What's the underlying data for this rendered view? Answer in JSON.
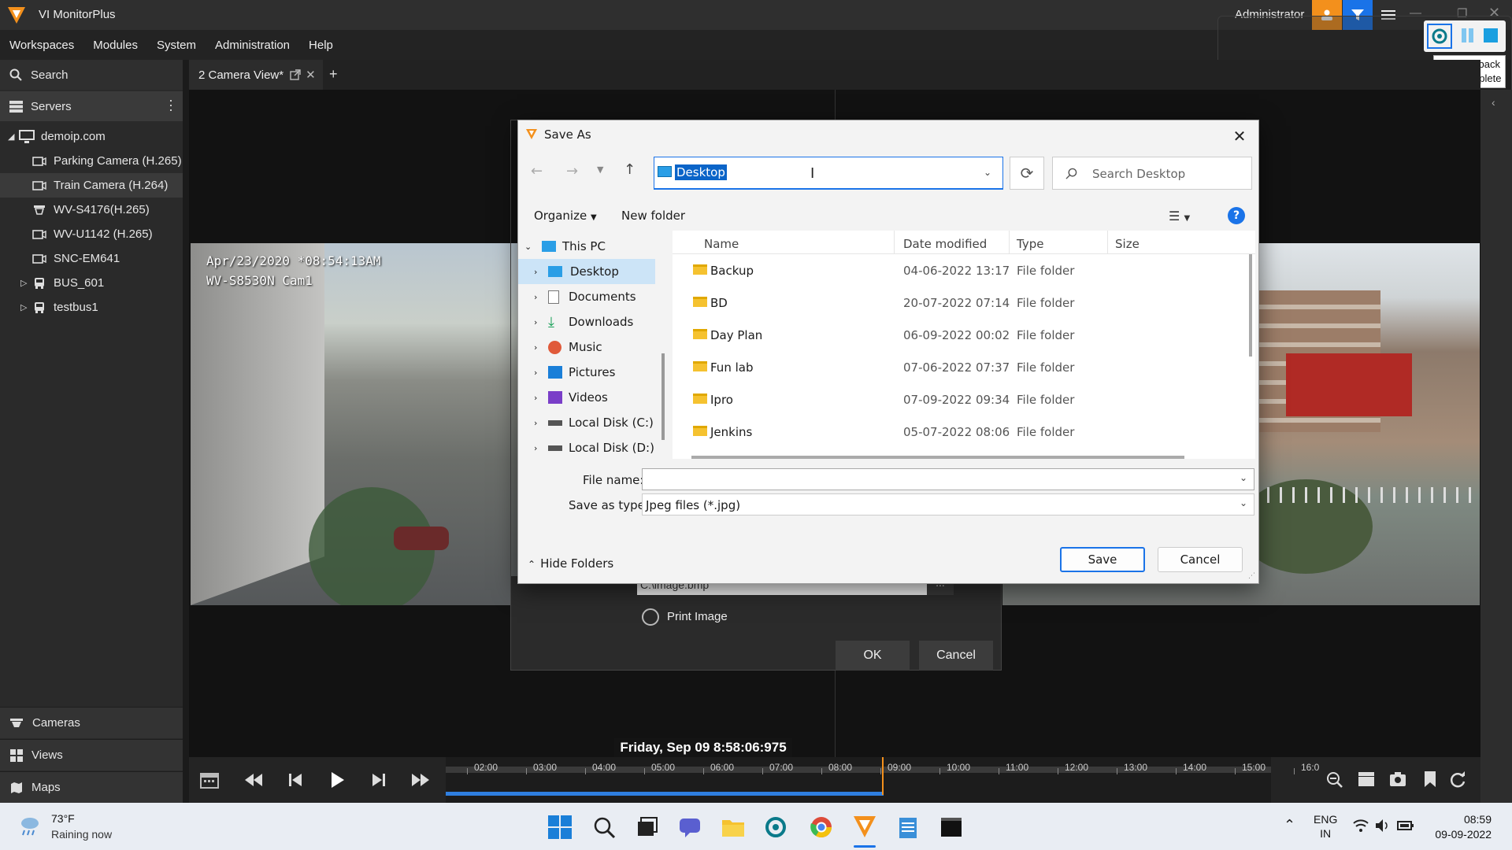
{
  "app": {
    "title": "VI MonitorPlus",
    "user": "Administrator",
    "colors": {
      "accent": "#f3901c",
      "brand_blue": "#1a73e8"
    }
  },
  "menu": [
    "Workspaces",
    "Modules",
    "System",
    "Administration",
    "Help"
  ],
  "sidebar": {
    "search_label": "Search",
    "servers_label": "Servers",
    "tree": {
      "server": "demoip.com",
      "items": [
        "Parking Camera (H.265)",
        "Train Camera (H.264)",
        "WV-S4176(H.265)",
        "WV-U1142 (H.265)",
        "SNC-EM641"
      ],
      "groups": [
        "BUS_601",
        "testbus1"
      ]
    },
    "bottom": [
      "Cameras",
      "Views",
      "Maps"
    ]
  },
  "tabs": {
    "active": "2 Camera View*",
    "add": "+"
  },
  "camera1": {
    "overlay_line1": "Apr/23/2020 *08:54:13AM",
    "overlay_line2": "WV-S8530N Cam1"
  },
  "tooltip": {
    "line1": "Playback",
    "line2": "TestComplete"
  },
  "behind_dialog": {
    "path_value": "C:\\image.bmp",
    "browse": "...",
    "print_label": "Print Image",
    "ok": "OK",
    "cancel": "Cancel"
  },
  "save_dialog": {
    "title": "Save As",
    "address": "Desktop",
    "search_placeholder": "Search Desktop",
    "organize": "Organize",
    "new_folder": "New folder",
    "nav": [
      "This PC",
      "Desktop",
      "Documents",
      "Downloads",
      "Music",
      "Pictures",
      "Videos",
      "Local Disk (C:)",
      "Local Disk (D:)"
    ],
    "columns": [
      "Name",
      "Date modified",
      "Type",
      "Size"
    ],
    "files": [
      {
        "name": "Backup",
        "date": "04-06-2022 13:17",
        "type": "File folder"
      },
      {
        "name": "BD",
        "date": "20-07-2022 07:14",
        "type": "File folder"
      },
      {
        "name": "Day Plan",
        "date": "06-09-2022 00:02",
        "type": "File folder"
      },
      {
        "name": "Fun lab",
        "date": "07-06-2022 07:37",
        "type": "File folder"
      },
      {
        "name": "Ipro",
        "date": "07-09-2022 09:34",
        "type": "File folder"
      },
      {
        "name": "Jenkins",
        "date": "05-07-2022 08:06",
        "type": "File folder"
      }
    ],
    "file_name_label": "File name:",
    "file_name_value": "",
    "save_type_label": "Save as type:",
    "save_type_value": "Jpeg files (*.jpg)",
    "hide_folders": "Hide Folders",
    "save": "Save",
    "cancel": "Cancel"
  },
  "timeline": {
    "datetime": "Friday, Sep 09  8:58:06:975",
    "hours": [
      "02:00",
      "03:00",
      "04:00",
      "05:00",
      "06:00",
      "07:00",
      "08:00",
      "09:00",
      "10:00",
      "11:00",
      "12:00",
      "13:00",
      "14:00",
      "15:00",
      "16:0"
    ]
  },
  "taskbar": {
    "weather_temp": "73°F",
    "weather_desc": "Raining now",
    "lang1": "ENG",
    "lang2": "IN",
    "time": "08:59",
    "date": "09-09-2022"
  }
}
